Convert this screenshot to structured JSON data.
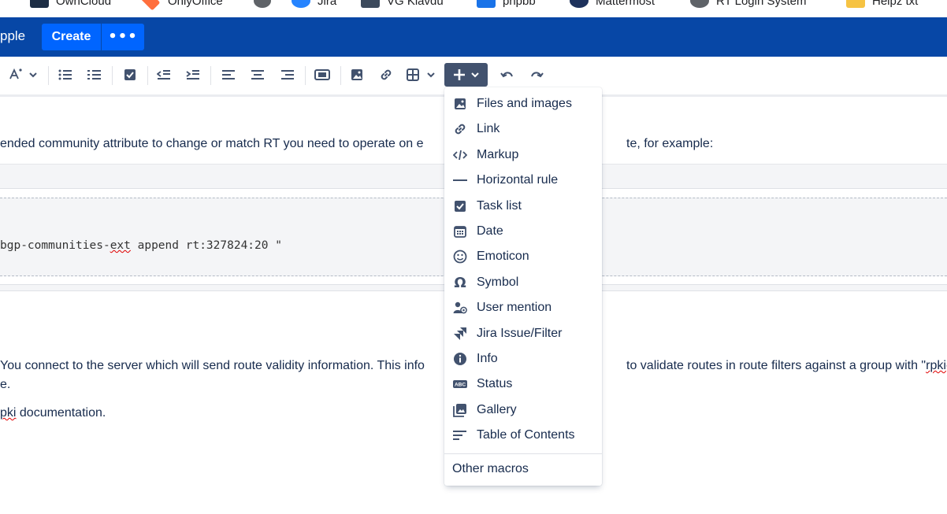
{
  "bookmarks": [
    {
      "label": "OwnCloud",
      "color": "#1d2d44"
    },
    {
      "label": "OnlyOffice",
      "color": "#ff6f3d"
    },
    {
      "label": "",
      "color": "#5f6368"
    },
    {
      "label": "Jira",
      "color": "#2684ff"
    },
    {
      "label": "VG Klavdu",
      "color": "#3c4a5c"
    },
    {
      "label": "phpbb",
      "color": "#1a73e8"
    },
    {
      "label": "Mattermost",
      "color": "#1e325c"
    },
    {
      "label": "RT Login System",
      "color": "#5f6368"
    },
    {
      "label": "Helpz txt",
      "color": "#f6c343"
    }
  ],
  "header": {
    "space_name": "pple",
    "create_label": "Create",
    "more_label": "•••",
    "bg_color": "#0747a6",
    "button_color": "#0065ff"
  },
  "toolbar": {
    "buttons": [
      "text-color",
      "bullet-list",
      "numbered-list",
      "task-list",
      "outdent",
      "indent",
      "align-left",
      "align-center",
      "align-right",
      "layouts",
      "insert-image",
      "insert-link",
      "insert-table",
      "insert-more",
      "undo",
      "redo"
    ]
  },
  "content": {
    "para1": "ended community attribute to change or match RT you need to operate on e",
    "para1_tail": "te, for example:",
    "code_a": "bgp-communities-",
    "code_b": "ext",
    "code_c": " append rt:327824:20 \"",
    "para2": " You connect to the server which will send route validity information. This info",
    "para2_tail_a": "to validate routes in route filters against a group with \"",
    "para2_tail_b": "rpki",
    "para2_tail_c": "-",
    "para3": "e.",
    "para4_a": "",
    "para4_b": "pki",
    "para4_c": " documentation."
  },
  "insert_menu": {
    "items": [
      {
        "label": "Files and images",
        "icon": "image-icon"
      },
      {
        "label": "Link",
        "icon": "link-icon"
      },
      {
        "label": "Markup",
        "icon": "code-icon"
      },
      {
        "label": "Horizontal rule",
        "icon": "horizontal-rule-icon"
      },
      {
        "label": "Task list",
        "icon": "checkbox-icon"
      },
      {
        "label": "Date",
        "icon": "calendar-icon"
      },
      {
        "label": "Emoticon",
        "icon": "emoji-icon"
      },
      {
        "label": "Symbol",
        "icon": "omega-icon"
      },
      {
        "label": "User mention",
        "icon": "mention-icon"
      },
      {
        "label": "Jira Issue/Filter",
        "icon": "jira-icon"
      },
      {
        "label": "Info",
        "icon": "info-icon"
      },
      {
        "label": "Status",
        "icon": "status-icon"
      },
      {
        "label": "Gallery",
        "icon": "gallery-icon"
      },
      {
        "label": "Table of Contents",
        "icon": "table-of-contents-icon"
      }
    ],
    "other_macros": "Other macros"
  }
}
